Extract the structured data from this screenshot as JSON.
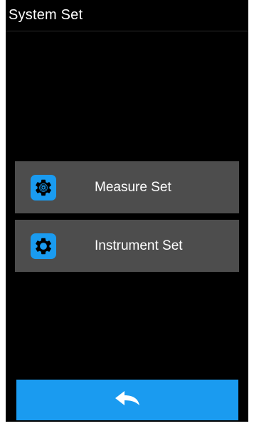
{
  "header": {
    "title": "System Set"
  },
  "menu": {
    "items": [
      {
        "label": "Measure Set",
        "icon": "target-gear-icon"
      },
      {
        "label": "Instrument Set",
        "icon": "gear-icon"
      }
    ]
  },
  "footer": {
    "back_icon": "back-arrow-icon"
  },
  "colors": {
    "background": "#000000",
    "menu_item": "#4d4d4d",
    "accent": "#1a9bf0",
    "text": "#ffffff"
  }
}
